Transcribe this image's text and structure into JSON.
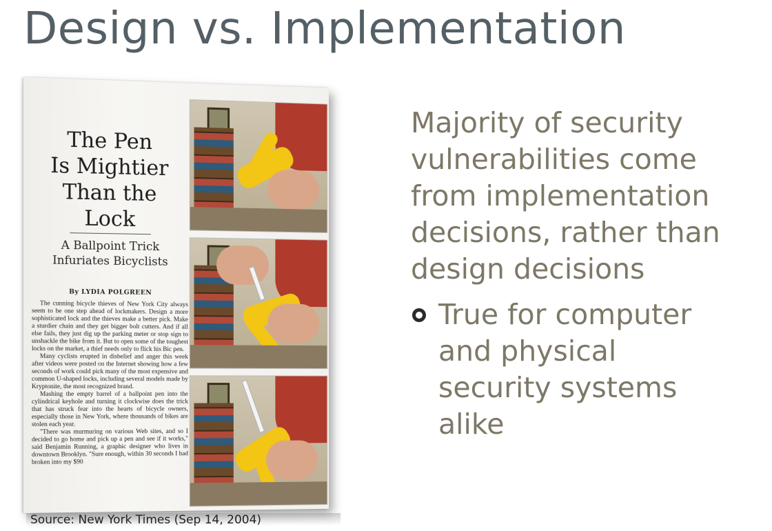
{
  "slide": {
    "title": "Design vs. Implementation",
    "main_point": "Majority of security vulnerabilities come from implementation decisions, rather than design decisions",
    "sub_bullet": "True for computer and physical security systems alike",
    "source_caption": "Source: New York Times (Sep 14, 2004)"
  },
  "article": {
    "headline_lines": [
      "The Pen",
      "Is Mightier",
      "Than the Lock"
    ],
    "subhead_lines": [
      "A Ballpoint Trick",
      "Infuriates Bicyclists"
    ],
    "byline": "By LYDIA POLGREEN",
    "paragraphs": [
      "The cunning bicycle thieves of New York City always seem to be one step ahead of lockmakers. Design a more sophisticated lock and the thieves make a better pick. Make a sturdier chain and they get bigger bolt cutters. And if all else fails, they just dig up the parking meter or stop sign to unshackle the bike from it. But to open some of the toughest locks on the market, a thief needs only to flick his Bic pen.",
      "Many cyclists erupted in disbelief and anger this week after videos were posted on the Internet showing how a few seconds of work could pick many of the most expensive and common U-shaped locks, including several models made by Kryptonite, the most recognized brand.",
      "Mashing the empty barrel of a ballpoint pen into the cylindrical keyhole and turning it clockwise does the trick that has struck fear into the hearts of bicycle owners, especially those in New York, where thousands of bikes are stolen each year.",
      "\"There was murmuring on various Web sites, and so I decided to go home and pick up a pen and see if it works,\" said Benjamin Running, a graphic designer who lives in downtown Brooklyn. \"Sure enough, within 30 seconds I had broken into my $90"
    ]
  },
  "colors": {
    "title": "#545f66",
    "body_text": "#7d7866",
    "bullet": "#2b2b2b",
    "lock_yellow": "#f3c514"
  }
}
